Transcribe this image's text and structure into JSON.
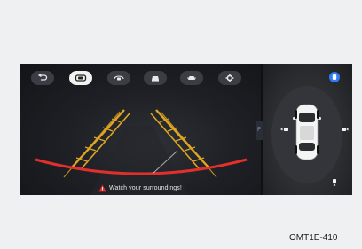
{
  "toolbar": {
    "buttons": [
      {
        "id": "back",
        "icon": "back-arrow-icon",
        "active": false
      },
      {
        "id": "rear-camera",
        "icon": "rear-camera-icon",
        "active": true
      },
      {
        "id": "camera-360",
        "icon": "camera-360-icon",
        "active": false
      },
      {
        "id": "front-camera",
        "icon": "front-car-icon",
        "active": false
      },
      {
        "id": "top-down",
        "icon": "top-down-car-icon",
        "active": false
      },
      {
        "id": "settings",
        "icon": "gear-icon",
        "active": false
      }
    ]
  },
  "side_tab": {
    "label": "F"
  },
  "warning": {
    "text": "Watch your surroundings!",
    "icon": "warning-triangle-icon"
  },
  "topview": {
    "icons": [
      "camera-top-icon",
      "camera-left-icon",
      "camera-right-icon",
      "camera-bottom-icon"
    ]
  },
  "colors": {
    "guide_yellow": "#e0a522",
    "guide_red": "#e0302c",
    "active_button": "#f2f2f2",
    "accent_blue": "#2f7bf2"
  },
  "caption": {
    "text": "OMT1E-410"
  }
}
